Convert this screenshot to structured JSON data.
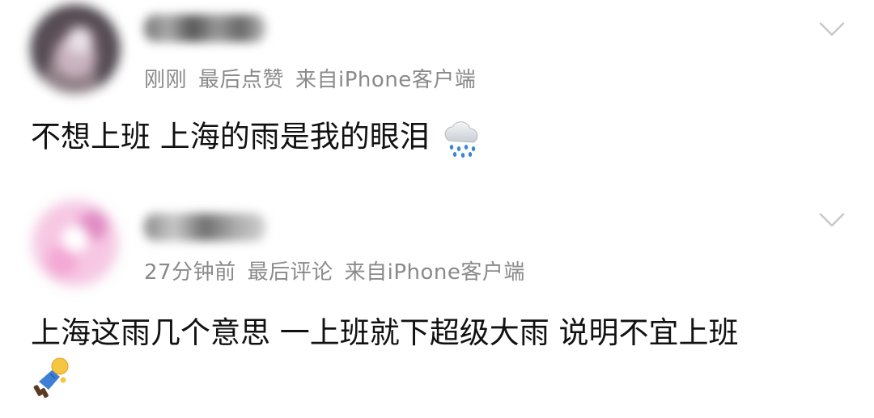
{
  "posts": [
    {
      "meta": {
        "time": "刚刚",
        "activity": "最后点赞",
        "source": "来自iPhone客户端"
      },
      "comment": {
        "text": "不想上班 上海的雨是我的眼泪",
        "emoji": "rain-cloud-icon"
      }
    },
    {
      "meta": {
        "time": "27分钟前",
        "activity": "最后评论",
        "source": "来自iPhone客户端"
      },
      "comment": {
        "text": "上海这雨几个意思 一上班就下超级大雨 说明不宜上班",
        "emoji": "lying-down-person-icon"
      }
    }
  ],
  "colors": {
    "meta_text": "#8a8a8a",
    "comment_text": "#111111",
    "chevron": "#c8c8c8"
  }
}
